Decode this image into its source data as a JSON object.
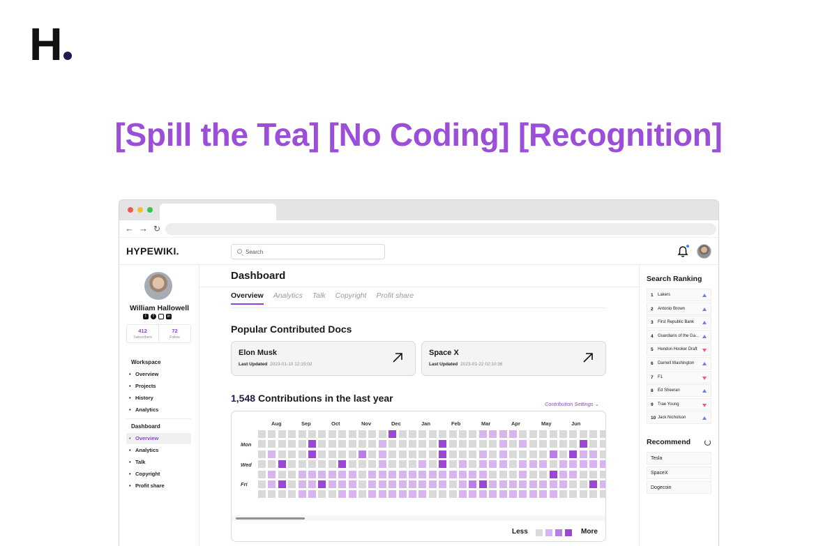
{
  "logo": {
    "letter": "H"
  },
  "headline": "[Spill the Tea] [No Coding] [Recognition]",
  "app": {
    "brand": "HYPEWIKI.",
    "search_placeholder": "Search"
  },
  "profile": {
    "name": "William Hallowell",
    "socials": [
      "twitter-icon",
      "facebook-icon",
      "instagram-icon",
      "linkedin-icon"
    ],
    "stats": [
      {
        "value": "412",
        "label": "Subscribers"
      },
      {
        "value": "72",
        "label": "Follow"
      }
    ]
  },
  "sidebar": {
    "workspace_title": "Workspace",
    "workspace_items": [
      "Overview",
      "Projects",
      "History",
      "Analytics"
    ],
    "dashboard_title": "Dashboard",
    "dashboard_items": [
      "Overview",
      "Analytics",
      "Talk",
      "Copyright",
      "Profit share"
    ],
    "active_item": "Overview"
  },
  "main": {
    "title": "Dashboard",
    "tabs": [
      "Overview",
      "Analytics",
      "Talk",
      "Copyright",
      "Profit share"
    ],
    "active_tab": "Overview",
    "popular_title": "Popular Contributed Docs",
    "docs": [
      {
        "name": "Elon Musk",
        "meta_label": "Last Updated",
        "updated": "2023-01-10 12:15:02"
      },
      {
        "name": "Space X",
        "meta_label": "Last Updated",
        "updated": "2023-01-22 02:10:36"
      }
    ],
    "contrib_count": "1,548",
    "contrib_text": "Contributions in the last year",
    "contrib_settings": "Contribution Settings",
    "months": [
      "Aug",
      "Sep",
      "Oct",
      "Nov",
      "Dec",
      "Jan",
      "Feb",
      "Mar",
      "Apr",
      "May",
      "Jun"
    ],
    "days": [
      "Mon",
      "Wed",
      "Fri"
    ],
    "heatmap_levels": [
      "00000000000000300000000000000000000000000000000000000000000000000000000",
      "00000300000000000000000000000000000000000000000000000000000000000000000"
    ],
    "heatmap_grid": [
      [
        0,
        0,
        0,
        0,
        0,
        0,
        0,
        0,
        0,
        0,
        0,
        0,
        0,
        3,
        0,
        0,
        0,
        0,
        0,
        0,
        0,
        0,
        1,
        1,
        1,
        1,
        0,
        0,
        0,
        0,
        0,
        0,
        0,
        0,
        0,
        0
      ],
      [
        0,
        0,
        0,
        0,
        0,
        3,
        0,
        0,
        0,
        0,
        0,
        0,
        1,
        0,
        0,
        0,
        0,
        0,
        3,
        0,
        0,
        0,
        0,
        0,
        1,
        0,
        1,
        0,
        0,
        0,
        0,
        0,
        3,
        0,
        0,
        0,
        3,
        0
      ],
      [
        0,
        1,
        0,
        0,
        0,
        3,
        0,
        0,
        0,
        0,
        2,
        0,
        1,
        0,
        0,
        0,
        0,
        0,
        3,
        0,
        0,
        0,
        1,
        0,
        1,
        0,
        0,
        0,
        0,
        2,
        0,
        3,
        1,
        1,
        0,
        0,
        3,
        0
      ],
      [
        0,
        0,
        3,
        0,
        0,
        0,
        0,
        0,
        3,
        0,
        0,
        0,
        1,
        0,
        0,
        0,
        1,
        0,
        3,
        0,
        1,
        0,
        1,
        1,
        1,
        0,
        1,
        1,
        1,
        0,
        1,
        1,
        1,
        1,
        1,
        1,
        1,
        1
      ],
      [
        0,
        1,
        0,
        0,
        1,
        1,
        1,
        1,
        1,
        1,
        0,
        1,
        1,
        1,
        1,
        1,
        1,
        1,
        1,
        1,
        1,
        1,
        1,
        0,
        0,
        0,
        1,
        0,
        0,
        3,
        1,
        1,
        0,
        0,
        0,
        3,
        1,
        1
      ],
      [
        0,
        1,
        3,
        0,
        1,
        1,
        3,
        1,
        1,
        1,
        0,
        1,
        1,
        1,
        1,
        1,
        1,
        1,
        1,
        0,
        1,
        2,
        3,
        1,
        1,
        1,
        1,
        1,
        1,
        1,
        1,
        0,
        0,
        3,
        1,
        1,
        3,
        1
      ],
      [
        0,
        0,
        0,
        0,
        1,
        1,
        0,
        0,
        1,
        1,
        0,
        1,
        1,
        1,
        1,
        1,
        1,
        0,
        0,
        0,
        1,
        1,
        1,
        1,
        1,
        1,
        1,
        1,
        1,
        1,
        0,
        0,
        0,
        0,
        0,
        0,
        0,
        1
      ]
    ],
    "legend_less": "Less",
    "legend_more": "More",
    "legend_colors": [
      "#d9d9d9",
      "#d8b4f0",
      "#b97fe6",
      "#9a47d6"
    ]
  },
  "right": {
    "ranking_title": "Search Ranking",
    "ranking": [
      {
        "no": "1",
        "name": "Lakers",
        "trend": "up"
      },
      {
        "no": "2",
        "name": "Antonio Brown",
        "trend": "up"
      },
      {
        "no": "3",
        "name": "First Republic Bank",
        "trend": "up"
      },
      {
        "no": "4",
        "name": "Guardians of the Ga...",
        "trend": "up"
      },
      {
        "no": "5",
        "name": "Hendon Hooker Draft",
        "trend": "down"
      },
      {
        "no": "6",
        "name": "Darnell Washington",
        "trend": "up"
      },
      {
        "no": "7",
        "name": "F1",
        "trend": "down"
      },
      {
        "no": "8",
        "name": "Ed Sheeran",
        "trend": "up"
      },
      {
        "no": "9",
        "name": "Trae Young",
        "trend": "down"
      },
      {
        "no": "10",
        "name": "Jack Nicholson",
        "trend": "up"
      }
    ],
    "recommend_title": "Recommend",
    "recommend": [
      "Tesla",
      "SpaceX",
      "Dogecoin"
    ]
  }
}
